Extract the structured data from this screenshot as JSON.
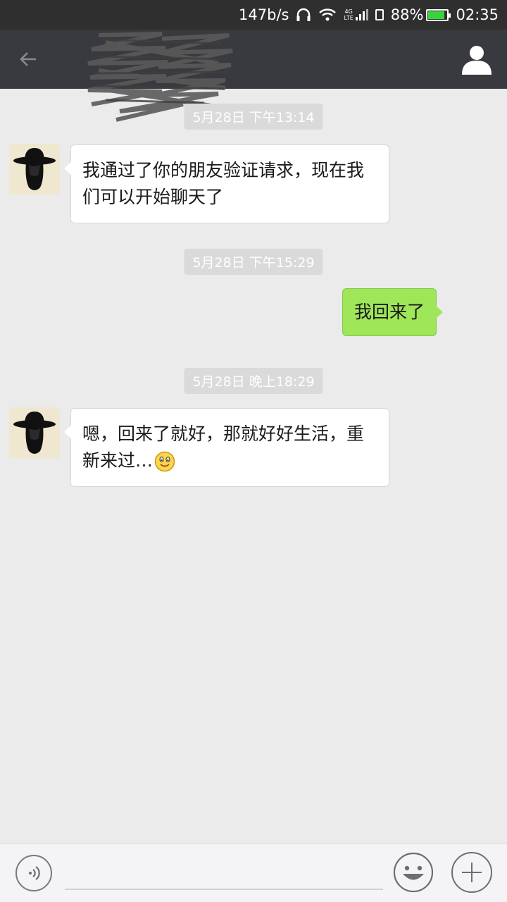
{
  "status_bar": {
    "net_speed": "147b/s",
    "net_type_top": "4G",
    "net_type_bottom": "LTE",
    "battery": "88%",
    "battery_level": 0.88,
    "time": "02:35",
    "battery_color": "#39d33a",
    "icons": [
      "headphones-icon",
      "wifi-icon",
      "signal-icon",
      "sim-icon",
      "battery-icon"
    ]
  },
  "top_bar": {
    "background": "#393a3f",
    "back_icon": "back-arrow-icon",
    "contact_icon": "person-icon"
  },
  "messages": [
    {
      "type": "timestamp",
      "text": "5月28日 下午13:14"
    },
    {
      "type": "incoming",
      "text": "我通过了你的朋友验证请求，现在我们可以开始聊天了"
    },
    {
      "type": "timestamp",
      "text": "5月28日 下午15:29"
    },
    {
      "type": "outgoing",
      "text": "我回来了"
    },
    {
      "type": "timestamp",
      "text": "5月28日 晚上18:29"
    },
    {
      "type": "incoming",
      "text": "嗯，回来了就好，那就好好生活，重新来过…",
      "emoji": "smile-emoji-icon"
    }
  ],
  "input_bar": {
    "voice_icon": "voice-icon",
    "text_value": "",
    "emoji_icon": "emoji-icon",
    "plus_icon": "plus-icon"
  },
  "colors": {
    "outgoing_bubble": "#9fe658",
    "incoming_bubble": "#ffffff",
    "chat_background": "#ebebeb"
  }
}
